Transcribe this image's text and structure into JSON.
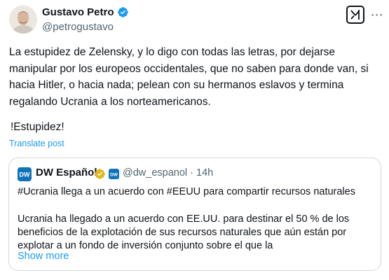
{
  "post": {
    "author": {
      "name": "Gustavo Petro",
      "handle": "@petrogustavo",
      "verified_icon": "verified-badge-icon",
      "verified_color": "#1d9bf0"
    },
    "text": "La estupidez de Zelensky, y lo digo con todas las letras, por dejarse manipular por los europeos occidentales, que no saben para donde van, si hacia Hitler, o hacia nada; pelean con su hermanos eslavos y termina regalando Ucrania a los norteamericanos.",
    "exclamation": "!Estupidez!",
    "translate_label": "Translate post"
  },
  "quote": {
    "author": {
      "name": "DW Español",
      "handle": "@dw_espanol",
      "separator": "·",
      "time": "14h",
      "gold_badge_color": "#e2b719",
      "brand_color": "#0e73b8"
    },
    "headline": "#Ucrania llega a un acuerdo con #EEUU para compartir recursos naturales",
    "body": "Ucrania ha llegado a un acuerdo con EE.UU. para destinar el 50 % de los beneficios de la explotación de sus recursos naturales que aún están por explotar a un fondo de inversión conjunto sobre el que la",
    "show_more": "Show more"
  },
  "colors": {
    "text_primary": "#0f1419",
    "text_secondary": "#536471",
    "link": "#1d9bf0",
    "border": "#cfd9de"
  }
}
